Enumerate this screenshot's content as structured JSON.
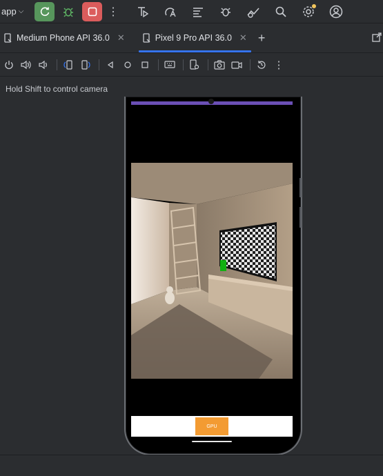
{
  "toolbar": {
    "app_label": "app",
    "colors": {
      "rerun": "#57965c",
      "stop": "#db5c5c",
      "debug": "#5fb865"
    },
    "icons": [
      "run-config-icon",
      "translate-icon",
      "logcat-icon",
      "bug-icon",
      "profiler-icon",
      "search-icon",
      "settings-icon",
      "account-icon"
    ]
  },
  "tabs": [
    {
      "label": "Medium Phone API 36.0",
      "active": false
    },
    {
      "label": "Pixel 9 Pro API 36.0",
      "active": true
    }
  ],
  "device_controls": [
    "power-icon",
    "volume-up-icon",
    "volume-down-icon",
    "rotate-left-icon",
    "rotate-right-icon",
    "back-icon",
    "home-icon",
    "overview-icon",
    "keyboard-icon",
    "device-settings-icon",
    "screenshot-icon",
    "record-icon",
    "reset-icon",
    "more-icon"
  ],
  "hint": "Hold Shift to control camera",
  "emulator": {
    "gpu_button": "GPU",
    "accent": "#f39b32",
    "status_color": "#6b4fb5"
  }
}
